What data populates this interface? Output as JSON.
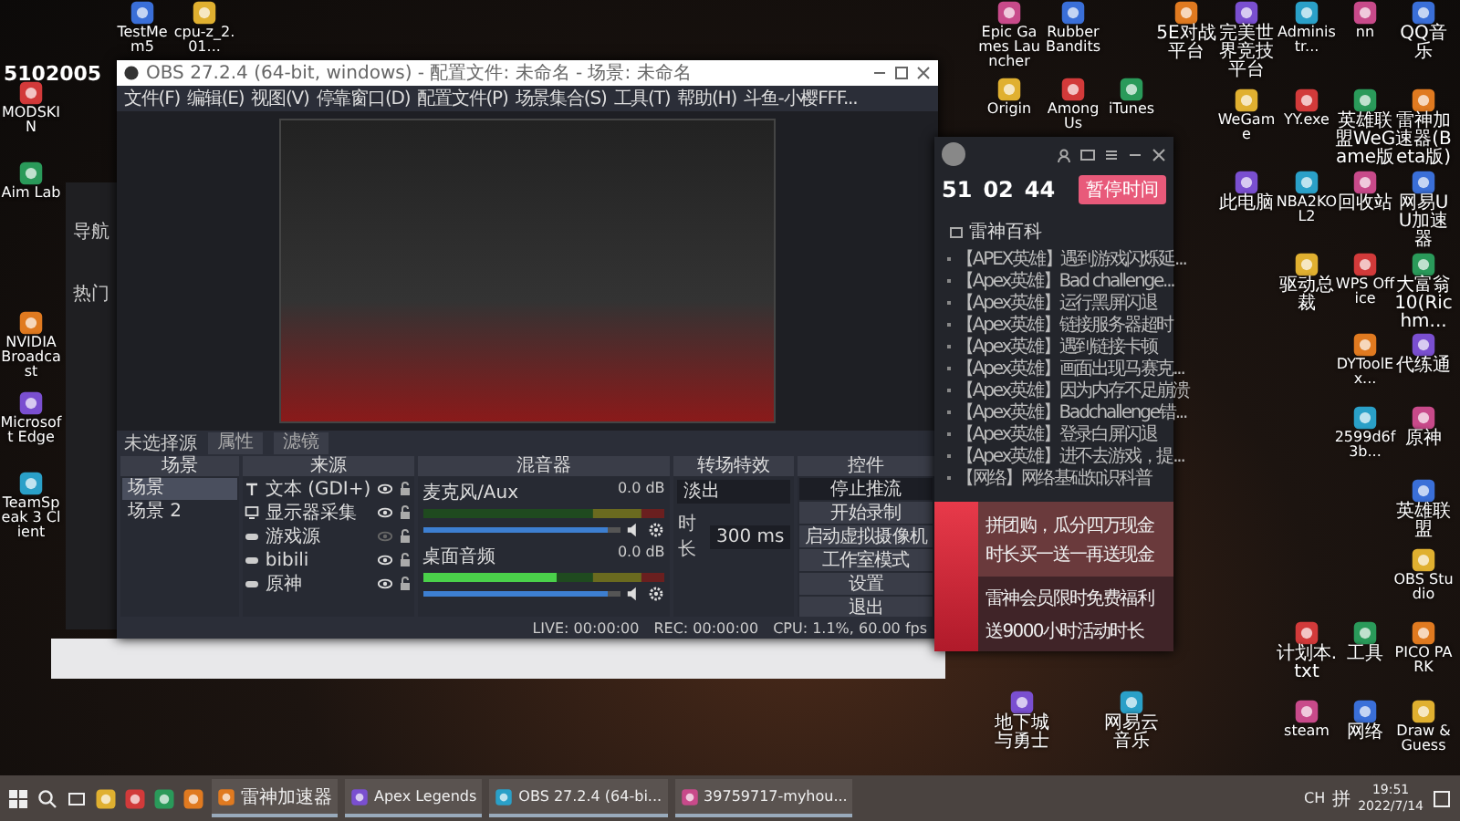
{
  "stream_overlay": "5102005",
  "desktop_icons": [
    {
      "label": "TestMem5"
    },
    {
      "label": "cpu-z_2.01..."
    },
    {
      "label": "MODSKIN"
    },
    {
      "label": "Aim Lab"
    },
    {
      "label": "NVIDIA Broadcast"
    },
    {
      "label": "Microsoft Edge"
    },
    {
      "label": "TeamSpeak 3 Client"
    },
    {
      "label": "Epic Games Launcher"
    },
    {
      "label": "Rubber Bandits"
    },
    {
      "label": "Origin"
    },
    {
      "label": "Among Us"
    },
    {
      "label": "iTunes"
    },
    {
      "label": "5E对战平台"
    },
    {
      "label": "完美世界竞技平台"
    },
    {
      "label": "Administr..."
    },
    {
      "label": "nn"
    },
    {
      "label": "QQ音乐"
    },
    {
      "label": "WeGame"
    },
    {
      "label": "YY.exe"
    },
    {
      "label": "英雄联盟WeGame版"
    },
    {
      "label": "雷神加速器(Beta版)"
    },
    {
      "label": "此电脑"
    },
    {
      "label": "NBA2KOL2"
    },
    {
      "label": "回收站"
    },
    {
      "label": "网易UU加速器"
    },
    {
      "label": "驱动总裁"
    },
    {
      "label": "WPS Office"
    },
    {
      "label": "大富翁10(Richm..."
    },
    {
      "label": "DYToolEx..."
    },
    {
      "label": "代练通"
    },
    {
      "label": "2599d6f3b..."
    },
    {
      "label": "原神"
    },
    {
      "label": "英雄联盟"
    },
    {
      "label": "OBS Studio"
    },
    {
      "label": "计划本.txt"
    },
    {
      "label": "工具"
    },
    {
      "label": "PICO PARK"
    },
    {
      "label": "地下城与勇士"
    },
    {
      "label": "网易云音乐"
    },
    {
      "label": "steam"
    },
    {
      "label": "网络"
    },
    {
      "label": "Draw & Guess"
    }
  ],
  "back_window": {
    "items": [
      "导航",
      "热门"
    ]
  },
  "obs": {
    "title": "OBS 27.2.4 (64-bit, windows) - 配置文件: 未命名 - 场景: 未命名",
    "menu": [
      "文件(F)",
      "编辑(E)",
      "视图(V)",
      "停靠窗口(D)",
      "配置文件(P)",
      "场景集合(S)",
      "工具(T)",
      "帮助(H)",
      "斗鱼-小樱FFF..."
    ],
    "source_bar": {
      "label": "未选择源",
      "buttons": [
        "属性",
        "滤镜"
      ]
    },
    "scenes": {
      "title": "场景",
      "items": [
        {
          "label": "场景",
          "selected": true
        },
        {
          "label": "场景 2",
          "selected": false
        }
      ]
    },
    "sources": {
      "title": "来源",
      "items": [
        {
          "kind": "text",
          "label": "文本 (GDI+)",
          "visible": true
        },
        {
          "kind": "monitor",
          "label": "显示器采集",
          "visible": true
        },
        {
          "kind": "game",
          "label": "游戏源",
          "visible": false
        },
        {
          "kind": "game",
          "label": "bibili",
          "visible": true
        },
        {
          "kind": "game",
          "label": "原神",
          "visible": true
        }
      ]
    },
    "mixer": {
      "title": "混音器",
      "channels": [
        {
          "name": "麦克风/Aux",
          "reading": "0.0 dB",
          "level": 0.93
        },
        {
          "name": "桌面音频",
          "reading": "0.0 dB",
          "level": 0.93
        }
      ]
    },
    "transitions": {
      "title": "转场特效",
      "type": "淡出",
      "duration_label": "时长",
      "duration": "300 ms"
    },
    "controls": {
      "title": "控件",
      "buttons": [
        {
          "label": "停止推流",
          "selected": true
        },
        {
          "label": "开始录制",
          "selected": false
        },
        {
          "label": "启动虚拟摄像机",
          "selected": false
        },
        {
          "label": "工作室模式",
          "selected": false
        },
        {
          "label": "设置",
          "selected": false
        },
        {
          "label": "退出",
          "selected": false
        }
      ]
    },
    "status": {
      "live": "LIVE: 00:00:00",
      "rec": "REC: 00:00:00",
      "cpu": "CPU: 1.1%, 60.00 fps"
    }
  },
  "booster": {
    "counters": [
      "51",
      "02",
      "44"
    ],
    "pause_button": "暂停时间",
    "section": "雷神百科",
    "articles": [
      "【APEX英雄】遇到游戏闪烁延...",
      "【Apex英雄】Bad challenge...",
      "【Apex英雄】运行黑屏闪退",
      "【Apex英雄】链接服务器超时",
      "【Apex英雄】遇到链接卡顿",
      "【Apex英雄】画面出现马赛克...",
      "【Apex英雄】因为内存不足崩溃",
      "【Apex英雄】Badchallenge错...",
      "【Apex英雄】登录白屏闪退",
      "【Apex英雄】进不去游戏，提...",
      "【网络】网络基础知识科普"
    ],
    "promo_title": "拼团购，瓜分四万现金",
    "promo_sub": "时长买一送一再送现金",
    "member_title": "雷神会员限时免费福利",
    "member_sub": "送9000小时活动时长"
  },
  "taskbar": {
    "apps": [
      {
        "label": "雷神加速器"
      },
      {
        "label": "Apex Legends"
      },
      {
        "label": "OBS 27.2.4 (64-bi..."
      },
      {
        "label": "39759717-myhou..."
      }
    ],
    "tray": [
      "CH",
      "拼"
    ],
    "time": "19:51",
    "date": "2022/7/14"
  }
}
